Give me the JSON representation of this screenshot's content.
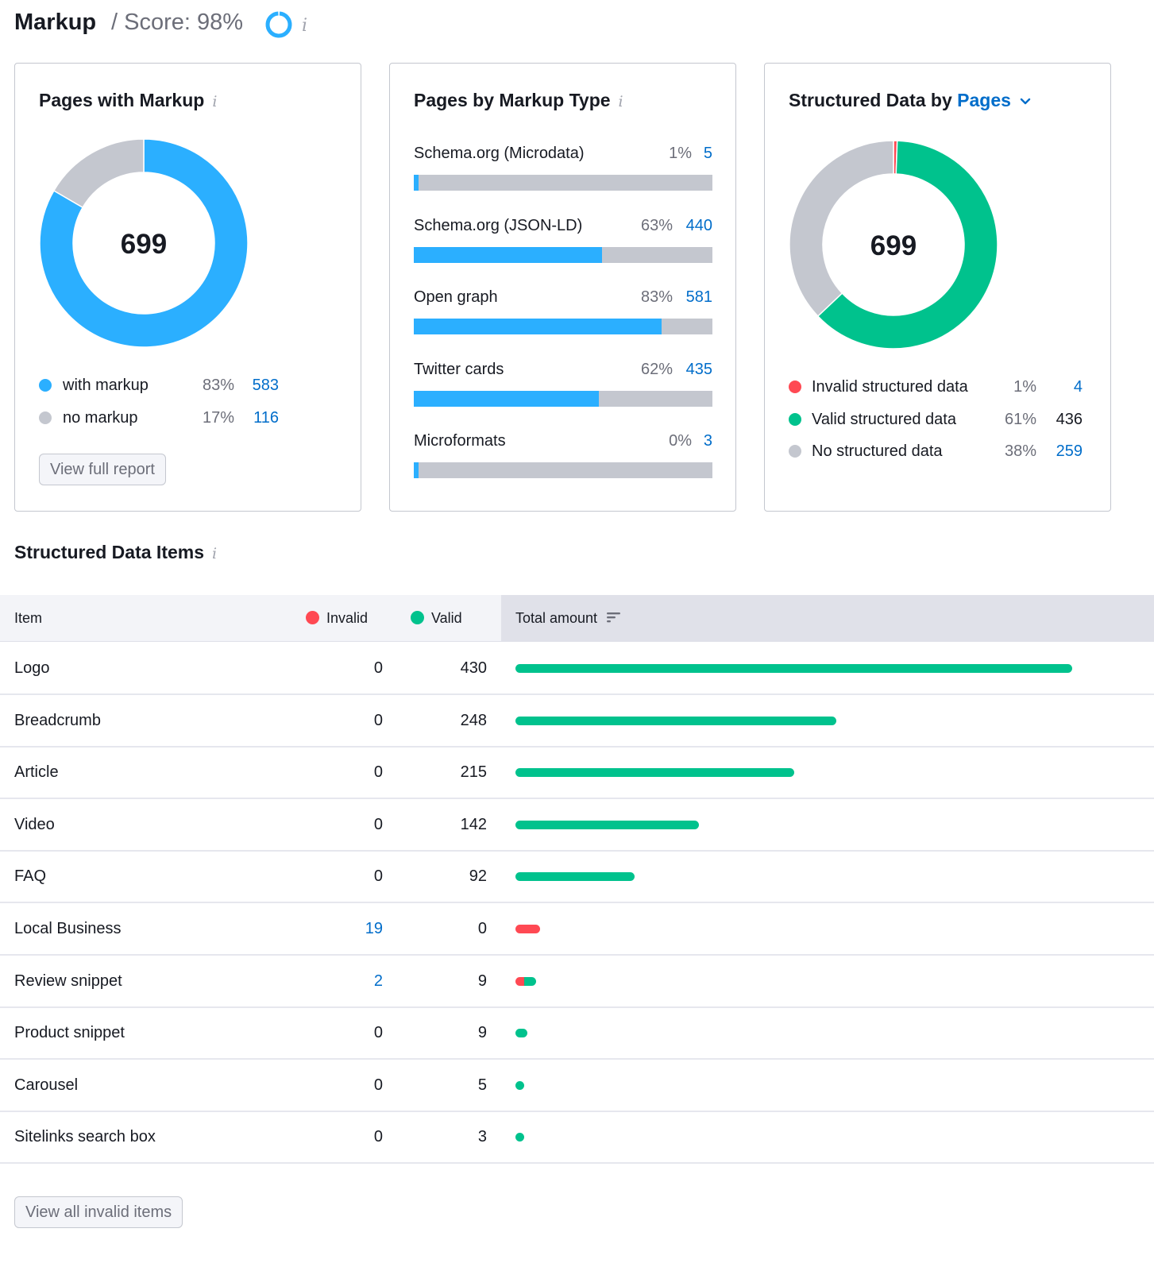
{
  "header": {
    "title": "Markup",
    "score_label": "/ Score: 98%",
    "score_value": 98,
    "info_icon": "i"
  },
  "colors": {
    "blue": "#2bafff",
    "gray": "#c4c7cf",
    "green": "#00c28d",
    "red": "#ff4953",
    "link": "#006dca"
  },
  "pages_with_markup": {
    "title": "Pages with Markup",
    "info_icon": "i",
    "total": "699",
    "legend": [
      {
        "label": "with markup",
        "pct": "83%",
        "value": "583",
        "color": "#2bafff",
        "count": 583
      },
      {
        "label": "no markup",
        "pct": "17%",
        "value": "116",
        "color": "#c4c7cf",
        "count": 116
      }
    ],
    "button": "View full report"
  },
  "markup_types": {
    "title": "Pages by Markup Type",
    "info_icon": "i",
    "rows": [
      {
        "label": "Schema.org (Microdata)",
        "pct": "1%",
        "value": "5",
        "fill": 0.01
      },
      {
        "label": "Schema.org (JSON-LD)",
        "pct": "63%",
        "value": "440",
        "fill": 0.63
      },
      {
        "label": "Open graph",
        "pct": "83%",
        "value": "581",
        "fill": 0.83
      },
      {
        "label": "Twitter cards",
        "pct": "62%",
        "value": "435",
        "fill": 0.62
      },
      {
        "label": "Microformats",
        "pct": "0%",
        "value": "3",
        "fill": 0.005
      }
    ]
  },
  "structured_by_pages": {
    "title_prefix": "Structured Data by",
    "title_dropdown": "Pages",
    "total": "699",
    "legend": [
      {
        "label": "Invalid structured data",
        "pct": "1%",
        "value": "4",
        "color": "#ff4953",
        "count": 4,
        "is_link": true
      },
      {
        "label": "Valid structured data",
        "pct": "61%",
        "value": "436",
        "color": "#00c28d",
        "count": 436,
        "is_link": false
      },
      {
        "label": "No structured data",
        "pct": "38%",
        "value": "259",
        "color": "#c4c7cf",
        "count": 259,
        "is_link": true
      }
    ]
  },
  "items_table": {
    "title": "Structured Data Items",
    "info_icon": "i",
    "columns": {
      "item": "Item",
      "invalid": "Invalid",
      "valid": "Valid",
      "total": "Total amount"
    },
    "max_total": 430,
    "rows": [
      {
        "item": "Logo",
        "invalid": 0,
        "valid": 430
      },
      {
        "item": "Breadcrumb",
        "invalid": 0,
        "valid": 248
      },
      {
        "item": "Article",
        "invalid": 0,
        "valid": 215
      },
      {
        "item": "Video",
        "invalid": 0,
        "valid": 142
      },
      {
        "item": "FAQ",
        "invalid": 0,
        "valid": 92
      },
      {
        "item": "Local Business",
        "invalid": 19,
        "valid": 0
      },
      {
        "item": "Review snippet",
        "invalid": 2,
        "valid": 9
      },
      {
        "item": "Product snippet",
        "invalid": 0,
        "valid": 9
      },
      {
        "item": "Carousel",
        "invalid": 0,
        "valid": 5
      },
      {
        "item": "Sitelinks search box",
        "invalid": 0,
        "valid": 3
      }
    ],
    "button": "View all invalid items"
  }
}
